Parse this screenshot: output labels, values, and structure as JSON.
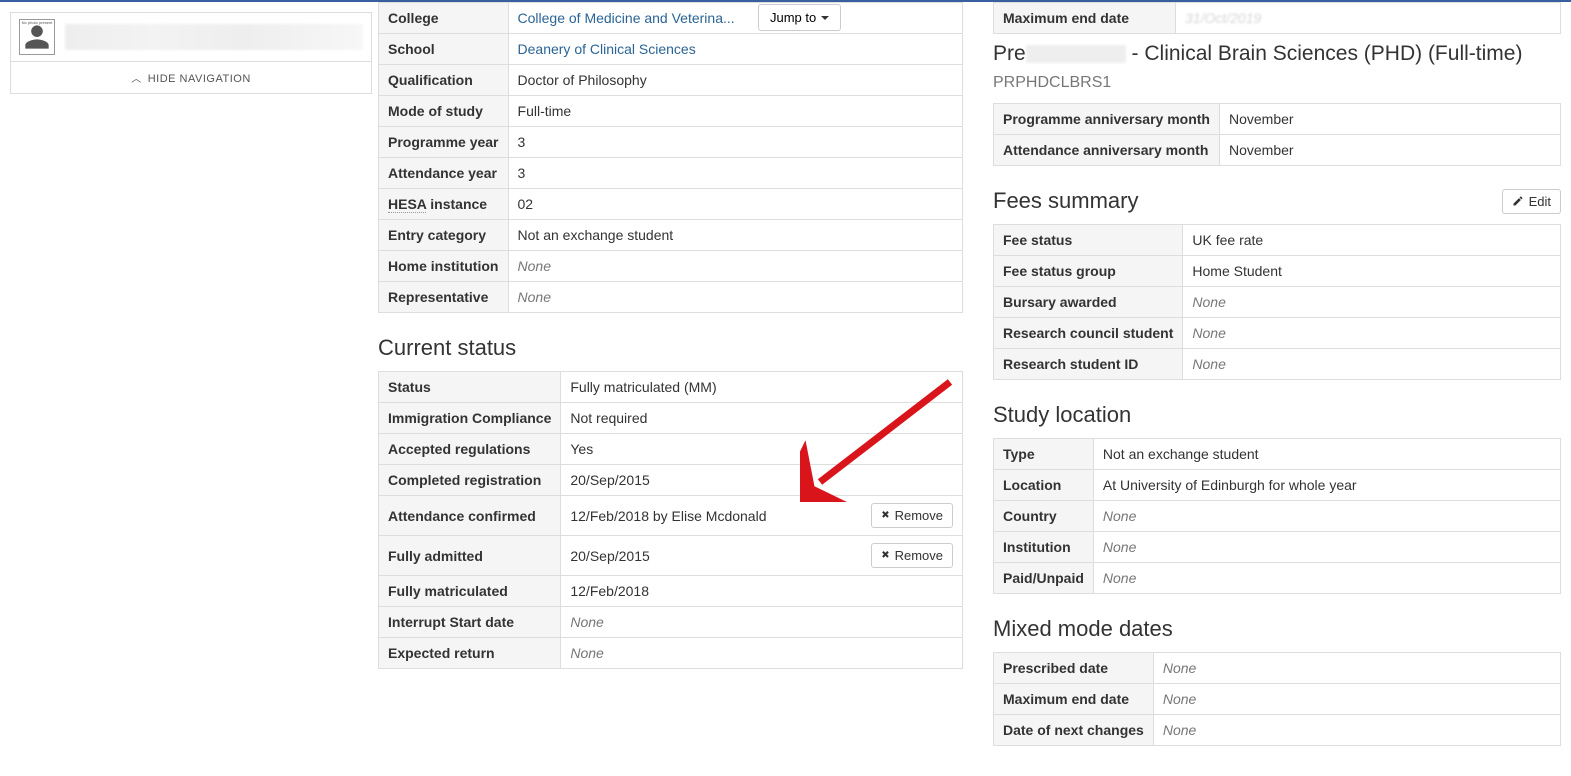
{
  "sidebar": {
    "hide_nav_label": "HIDE NAVIGATION",
    "avatar_hint": "No photo present"
  },
  "jump_to_label": "Jump to",
  "programme_info": {
    "rows": [
      {
        "label": "College",
        "value": "College of Medicine and Veterina...",
        "link": true,
        "faded": true
      },
      {
        "label": "School",
        "value": "Deanery of Clinical Sciences",
        "link": true,
        "faded": true
      },
      {
        "label": "Qualification",
        "value": "Doctor of Philosophy"
      },
      {
        "label": "Mode of study",
        "value": "Full-time"
      },
      {
        "label": "Programme year",
        "value": "3"
      },
      {
        "label": "Attendance year",
        "value": "3"
      },
      {
        "label": "HESA instance",
        "value": "02",
        "dotted_label": "HESA"
      },
      {
        "label": "Entry category",
        "value": "Not an exchange student"
      },
      {
        "label": "Home institution",
        "value": "None",
        "none": true
      },
      {
        "label": "Representative",
        "value": "None",
        "none": true
      }
    ]
  },
  "current_status": {
    "title": "Current status",
    "rows": [
      {
        "label": "Status",
        "value": "Fully matriculated (MM)"
      },
      {
        "label": "Immigration Compliance",
        "value": "Not required"
      },
      {
        "label": "Accepted regulations",
        "value": "Yes"
      },
      {
        "label": "Completed registration",
        "value": "20/Sep/2015"
      },
      {
        "label": "Attendance confirmed",
        "value": "12/Feb/2018 by Elise Mcdonald",
        "remove": true
      },
      {
        "label": "Fully admitted",
        "value": "20/Sep/2015",
        "remove": true
      },
      {
        "label": "Fully matriculated",
        "value": "12/Feb/2018"
      },
      {
        "label": "Interrupt Start date",
        "value": "None",
        "none": true
      },
      {
        "label": "Expected return",
        "value": "None",
        "none": true
      }
    ],
    "remove_label": "Remove"
  },
  "prog_header": {
    "pre": "Pre",
    "mid": "- Clinical Brain Sciences (PHD) (Full-time)",
    "code": "PRPHDCLBRS1",
    "max_end_date_label": "Maximum end date",
    "max_end_date_value_faded": "31/Oct/2019"
  },
  "anniversary": {
    "rows": [
      {
        "label": "Programme anniversary month",
        "value": "November"
      },
      {
        "label": "Attendance anniversary month",
        "value": "November"
      }
    ]
  },
  "fees": {
    "title": "Fees summary",
    "edit_label": "Edit",
    "rows": [
      {
        "label": "Fee status",
        "value": "UK fee rate"
      },
      {
        "label": "Fee status group",
        "value": "Home Student"
      },
      {
        "label": "Bursary awarded",
        "value": "None",
        "none": true
      },
      {
        "label": "Research council student",
        "value": "None",
        "none": true
      },
      {
        "label": "Research student ID",
        "value": "None",
        "none": true
      }
    ]
  },
  "study_location": {
    "title": "Study location",
    "rows": [
      {
        "label": "Type",
        "value": "Not an exchange student"
      },
      {
        "label": "Location",
        "value": "At University of Edinburgh for whole year"
      },
      {
        "label": "Country",
        "value": "None",
        "none": true
      },
      {
        "label": "Institution",
        "value": "None",
        "none": true
      },
      {
        "label": "Paid/Unpaid",
        "value": "None",
        "none": true
      }
    ]
  },
  "mixed_mode": {
    "title": "Mixed mode dates",
    "rows": [
      {
        "label": "Prescribed date",
        "value": "None",
        "none": true
      },
      {
        "label": "Maximum end date",
        "value": "None",
        "none": true
      },
      {
        "label": "Date of next changes",
        "value": "None",
        "none": true
      }
    ]
  }
}
